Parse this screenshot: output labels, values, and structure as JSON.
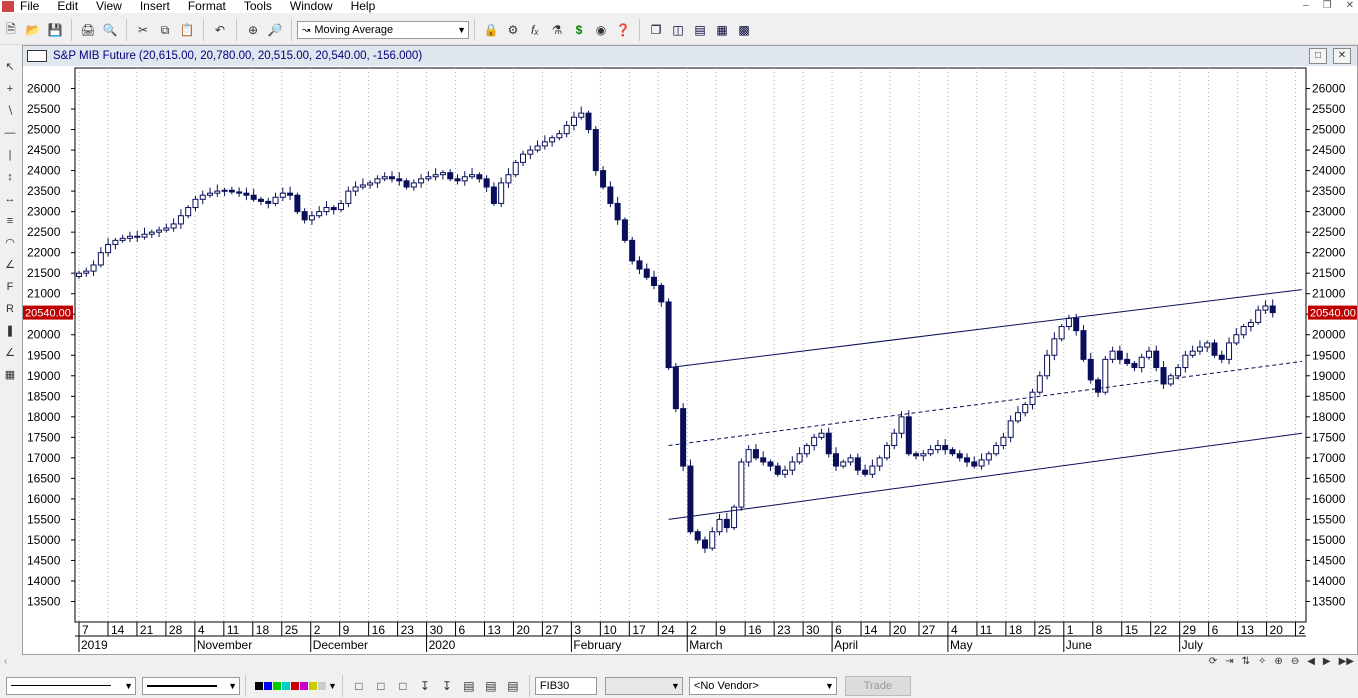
{
  "menu": {
    "items": [
      "File",
      "Edit",
      "View",
      "Insert",
      "Format",
      "Tools",
      "Window",
      "Help"
    ]
  },
  "toolbar": {
    "indicator_select": "Moving Average"
  },
  "chart_window": {
    "title": "S&P MIB Future",
    "quote": "(20,615.00, 20,780.00, 20,515.00, 20,540.00, -156.000)",
    "last_price_label": "20540.00"
  },
  "bottom": {
    "symbol": "FIB30",
    "vendor": "<No Vendor>",
    "trade_button": "Trade"
  },
  "colors": {
    "candle_down": "#0a0f5a",
    "candle_up": "#ffffff",
    "channel": "#0a0f5a",
    "last_price_bg": "#c00000"
  },
  "chart_data": {
    "type": "candlestick",
    "ylim": [
      13000,
      26500
    ],
    "y_ticks": [
      13500,
      14000,
      14500,
      15000,
      15500,
      16000,
      16500,
      17000,
      17500,
      18000,
      18500,
      19000,
      19500,
      20000,
      20500,
      21000,
      21500,
      22000,
      22500,
      23000,
      23500,
      24000,
      24500,
      25000,
      25500,
      26000
    ],
    "x_day_labels": [
      "7",
      "14",
      "21",
      "28",
      "4",
      "11",
      "18",
      "25",
      "2",
      "9",
      "16",
      "23",
      "30",
      "6",
      "13",
      "20",
      "27",
      "3",
      "10",
      "17",
      "24",
      "2",
      "9",
      "16",
      "23",
      "30",
      "6",
      "14",
      "20",
      "27",
      "4",
      "11",
      "18",
      "25",
      "1",
      "8",
      "15",
      "22",
      "29",
      "6",
      "13",
      "20",
      "2"
    ],
    "x_month_labels": [
      "2019",
      "November",
      "December",
      "2020",
      "February",
      "March",
      "April",
      "May",
      "June",
      "July"
    ],
    "closes": [
      21500,
      21550,
      21700,
      22000,
      22200,
      22300,
      22350,
      22400,
      22380,
      22450,
      22500,
      22550,
      22600,
      22700,
      22900,
      23100,
      23300,
      23400,
      23450,
      23500,
      23520,
      23480,
      23450,
      23400,
      23300,
      23250,
      23200,
      23350,
      23450,
      23400,
      23000,
      22800,
      22900,
      23000,
      23100,
      23050,
      23200,
      23500,
      23600,
      23650,
      23700,
      23800,
      23850,
      23800,
      23750,
      23600,
      23700,
      23800,
      23850,
      23900,
      23950,
      23800,
      23750,
      23850,
      23900,
      23800,
      23600,
      23200,
      23700,
      23900,
      24200,
      24400,
      24500,
      24600,
      24700,
      24800,
      24900,
      25100,
      25300,
      25400,
      25000,
      24000,
      23600,
      23200,
      22800,
      22300,
      21800,
      21600,
      21400,
      21200,
      20800,
      19200,
      18200,
      16800,
      15200,
      15000,
      14800,
      15200,
      15500,
      15300,
      15800,
      16900,
      17200,
      17000,
      16900,
      16800,
      16600,
      16700,
      16900,
      17100,
      17300,
      17500,
      17600,
      17100,
      16800,
      16900,
      17000,
      16700,
      16600,
      16800,
      17000,
      17300,
      17600,
      18000,
      17100,
      17050,
      17100,
      17200,
      17300,
      17200,
      17100,
      17000,
      16900,
      16800,
      16950,
      17100,
      17300,
      17500,
      17900,
      18100,
      18300,
      18600,
      19000,
      19500,
      19900,
      20200,
      20400,
      20100,
      19400,
      18900,
      18600,
      19400,
      19600,
      19400,
      19300,
      19200,
      19450,
      19600,
      19200,
      18800,
      19000,
      19200,
      19500,
      19600,
      19700,
      19800,
      19500,
      19400,
      19800,
      20000,
      20200,
      20300,
      20600,
      20700,
      20540
    ],
    "channel": {
      "upper_start": 19200,
      "upper_end": 21100,
      "mid_start": 17300,
      "mid_end": 19350,
      "lower_start": 15500,
      "lower_end": 17600
    },
    "last_price": 20540
  }
}
